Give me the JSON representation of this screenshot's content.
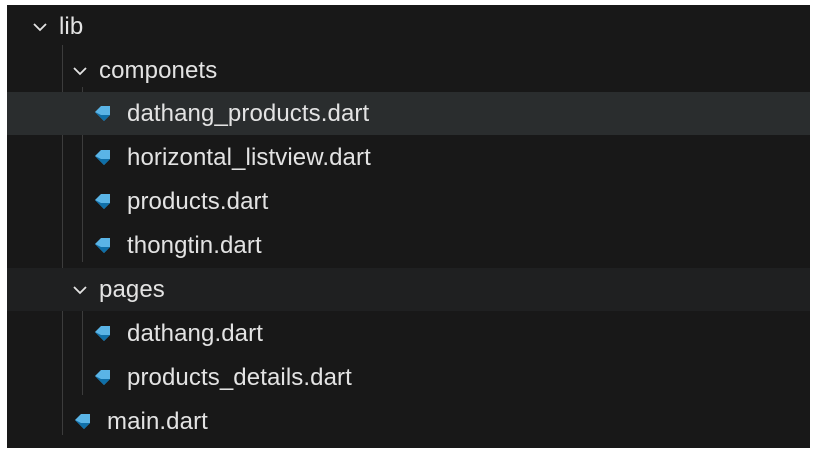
{
  "tree": {
    "root_folder": "lib",
    "subfolder_1": "componets",
    "subfolder_1_files": [
      "dathang_products.dart",
      "horizontal_listview.dart",
      "products.dart",
      "thongtin.dart"
    ],
    "subfolder_2": "pages",
    "subfolder_2_files": [
      "dathang.dart",
      "products_details.dart"
    ],
    "root_file": "main.dart"
  },
  "icons": {
    "folder_expanded": "chevron-down-icon",
    "dart_file": "dart-icon"
  },
  "colors": {
    "background": "#181818",
    "hover_row": "#2a2d2e",
    "text": "#e3e3e3",
    "dart_icon": "#5ab4e6",
    "dart_icon_dark": "#0f6fa8"
  }
}
